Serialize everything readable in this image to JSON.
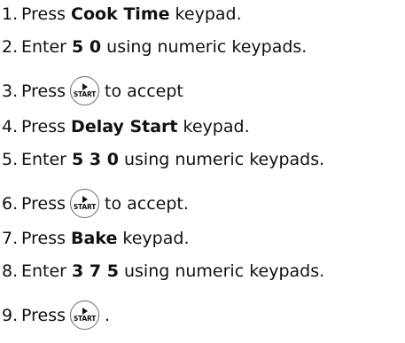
{
  "steps": [
    {
      "num": "1.",
      "pre": "Press ",
      "bold": "Cook Time",
      "post": " keypad."
    },
    {
      "num": "2.",
      "pre": "Enter ",
      "bold": "5 0",
      "post": " using numeric keypads."
    },
    {
      "num": "3.",
      "pre": "Press",
      "button_label": "START",
      "post": "to accept"
    },
    {
      "num": "4.",
      "pre": "Press ",
      "bold": "Delay Start",
      "post": " keypad."
    },
    {
      "num": "5.",
      "pre": "Enter ",
      "bold": "5 3 0",
      "post": " using numeric keypads."
    },
    {
      "num": "6.",
      "pre": "Press",
      "button_label": "START",
      "post": "to accept."
    },
    {
      "num": "7.",
      "pre": "Press ",
      "bold": "Bake",
      "post": " keypad."
    },
    {
      "num": "8.",
      "pre": "Enter ",
      "bold": "3 7 5",
      "post": " using numeric keypads."
    },
    {
      "num": "9.",
      "pre": "Press",
      "button_label": "START",
      "post": "."
    }
  ],
  "icons": {
    "start_button": "start-play-icon"
  }
}
